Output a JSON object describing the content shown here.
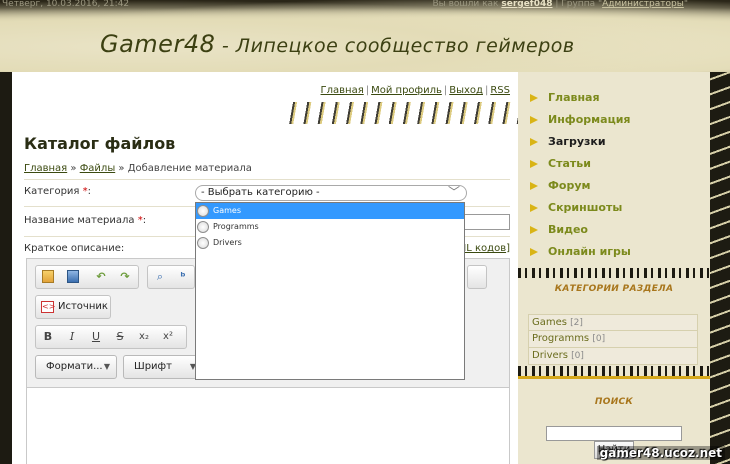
{
  "topbar": {
    "date": "Четверг, 10.03.2016, 21:42",
    "logged_in_prefix": "Вы вошли как",
    "username": "sergef048",
    "group_prefix": "| Группа \"",
    "group": "Администраторы",
    "group_suffix": "\""
  },
  "site": {
    "title": "Gamer48",
    "subtitle": " - Липецкое сообщество геймеров"
  },
  "toplinks": [
    "Главная",
    "Мой профиль",
    "Выход",
    "RSS"
  ],
  "page": {
    "title": "Каталог файлов",
    "breadcrumb": {
      "home": "Главная",
      "sep1": " » ",
      "files": "Файлы",
      "sep2": " » ",
      "current": "Добавление материала"
    }
  },
  "form": {
    "category_label": "Категория",
    "required_mark": "*",
    "colon": ":",
    "category_value": "- Выбрать категорию -",
    "name_label": "Название материала",
    "short_desc_label": "Краткое описание:",
    "html_codes": "ML кодов",
    "html_codes_bracket": "]"
  },
  "editor": {
    "source_label": "Источник",
    "format_combo": "Формати...",
    "font_combo": "Шрифт",
    "bold": "B",
    "italic": "I",
    "underline": "U",
    "strike": "S",
    "subscript": "x₂",
    "superscript": "x²"
  },
  "dropdown": {
    "options": [
      "Games",
      "Programms",
      "Drivers"
    ],
    "selected_index": 0
  },
  "sidebar": {
    "nav": [
      {
        "label": "Главная",
        "active": false
      },
      {
        "label": "Информация",
        "active": false
      },
      {
        "label": "Загрузки",
        "active": true
      },
      {
        "label": "Статьи",
        "active": false
      },
      {
        "label": "Форум",
        "active": false
      },
      {
        "label": "Скриншоты",
        "active": false
      },
      {
        "label": "Видео",
        "active": false
      },
      {
        "label": "Онлайн игры",
        "active": false
      }
    ],
    "categories_title": "КАТЕГОРИИ РАЗДЕЛА",
    "categories": [
      {
        "name": "Games",
        "count": "[2]"
      },
      {
        "name": "Programms",
        "count": "[0]"
      },
      {
        "name": "Drivers",
        "count": "[0]"
      }
    ],
    "search_title": "ПОИСК",
    "search_button": "Найти"
  },
  "watermark": "gamer48.ucoz.net",
  "colors": {
    "accent_gold": "#d5a81a",
    "nav_green": "#7c8a1c",
    "link_dark": "#3b4a10",
    "selection_blue": "#3399ff"
  }
}
